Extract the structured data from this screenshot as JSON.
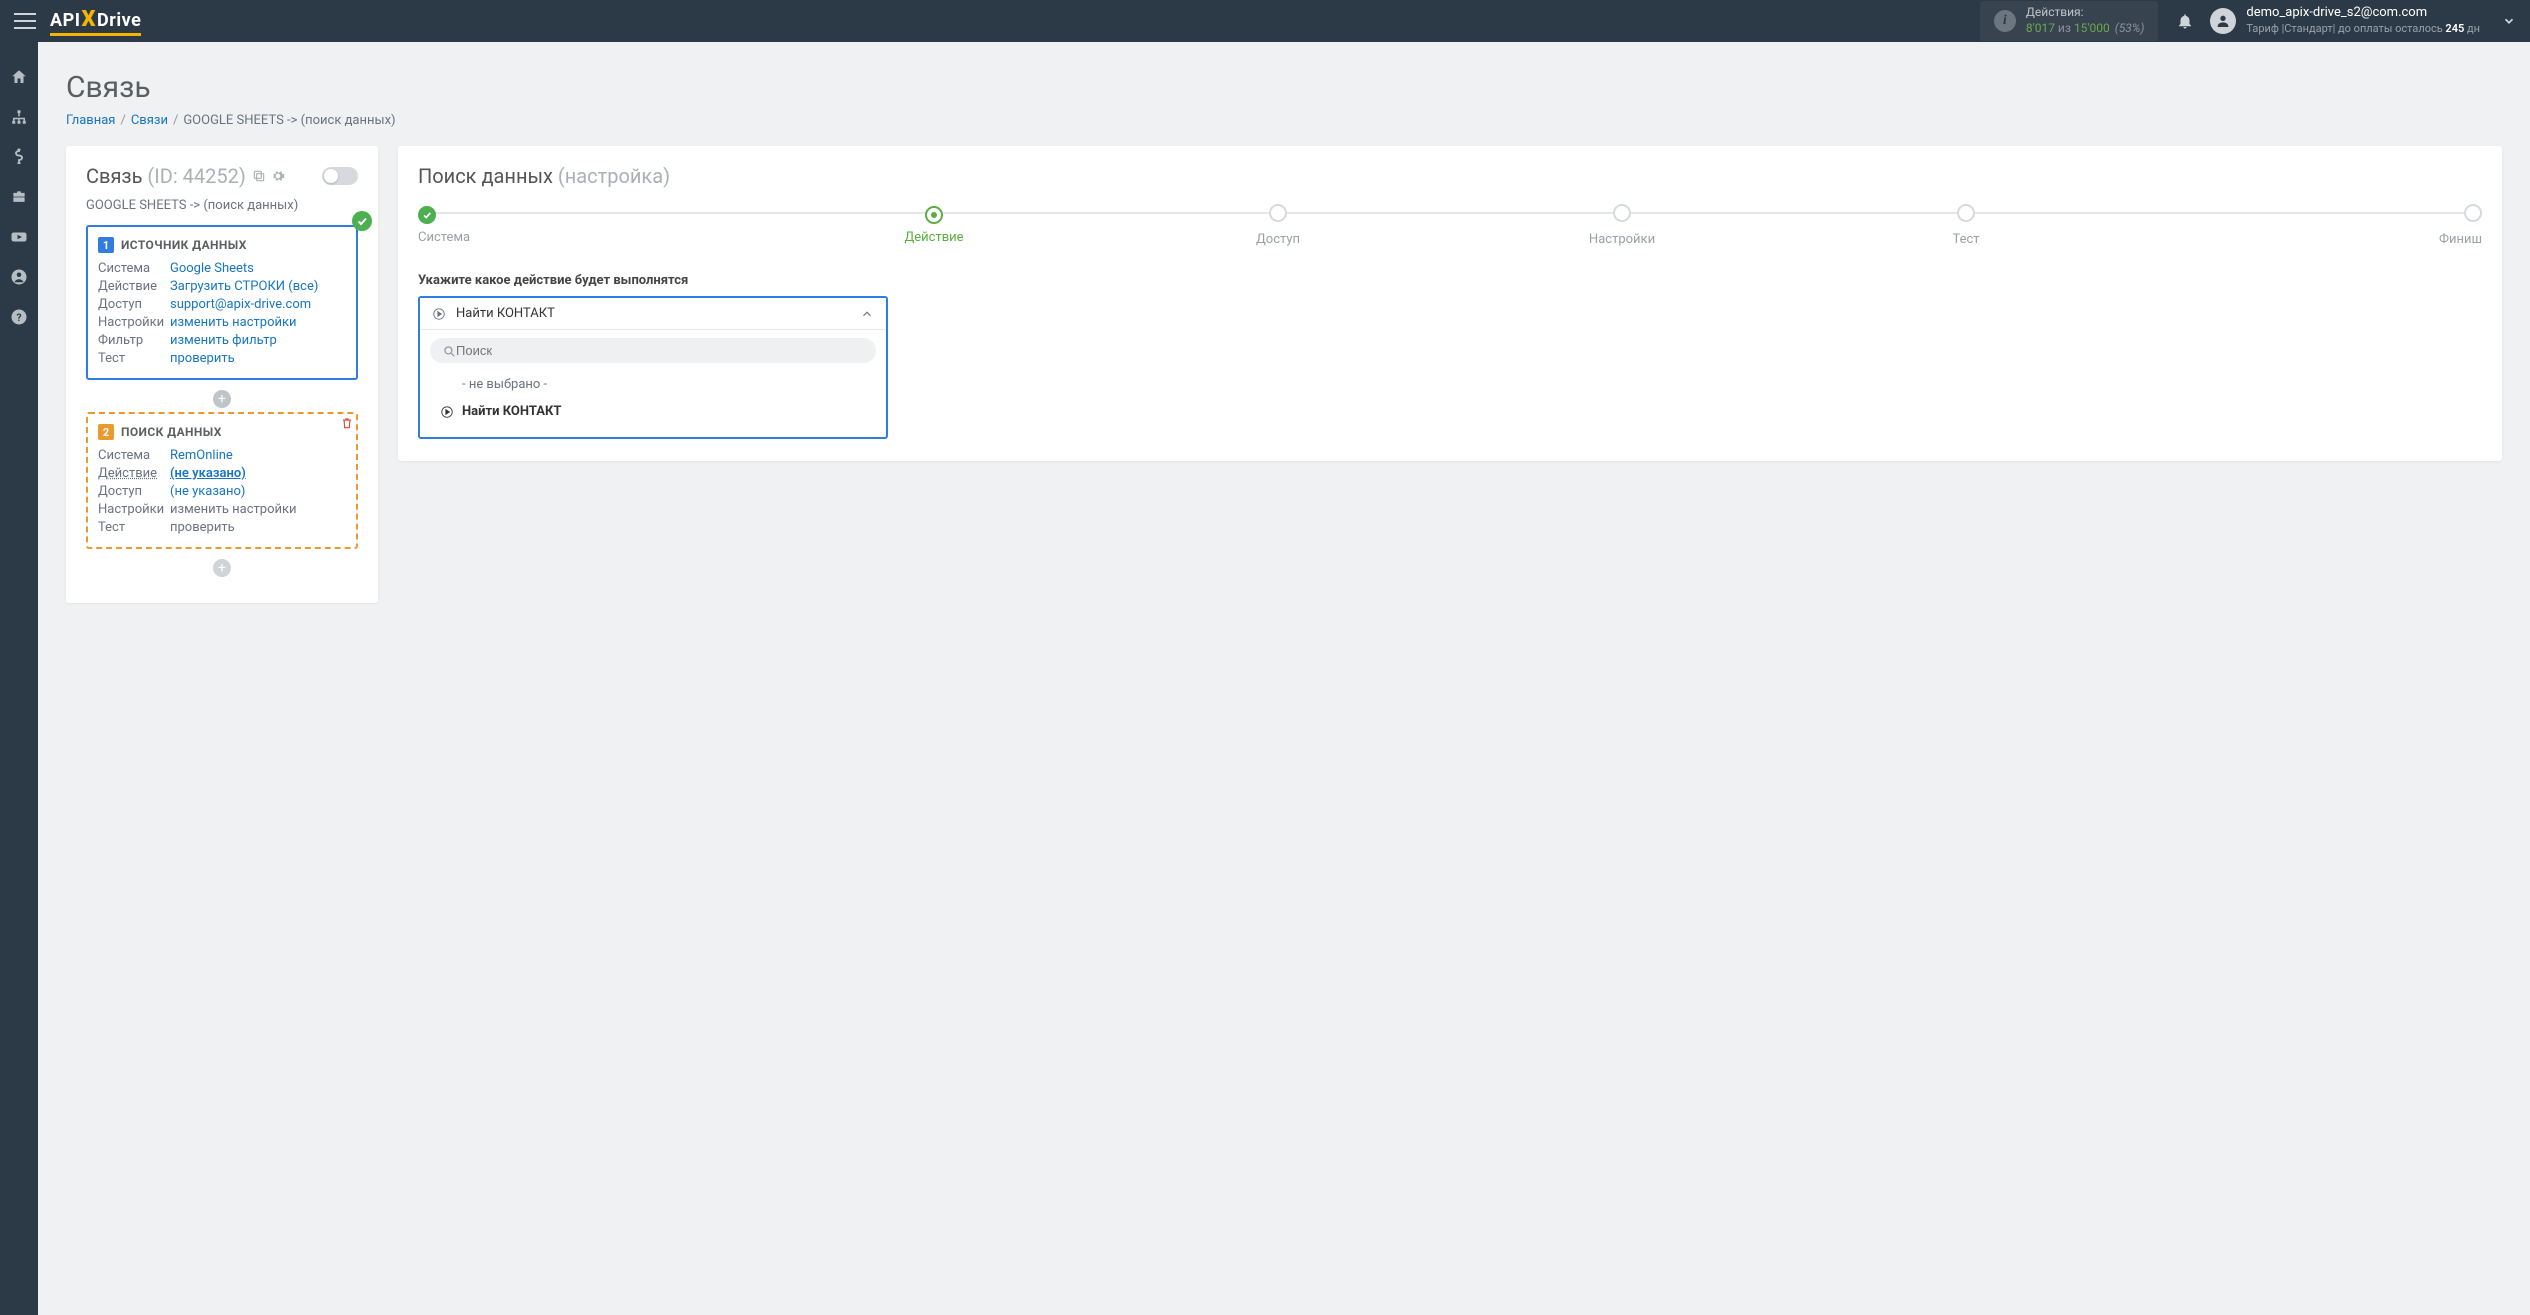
{
  "brand": {
    "api": "API",
    "x": "X",
    "drive": "Drive"
  },
  "header": {
    "actions_label": "Действия:",
    "used": "8'017",
    "of": " из ",
    "limit": "15'000",
    "pct": "(53%)",
    "user_email": "demo_apix-drive_s2@com.com",
    "tariff_prefix": "Тариф |Стандарт| до оплаты осталось ",
    "tariff_days": "245",
    "tariff_suffix": " дн"
  },
  "page": {
    "title": "Связь",
    "crumbs": {
      "home": "Главная",
      "links": "Связи",
      "current": "GOOGLE SHEETS -> (поиск данных)"
    }
  },
  "left": {
    "title": "Связь",
    "id_text": "(ID: 44252)",
    "path": "GOOGLE SHEETS -> (поиск данных)",
    "block1": {
      "title": "ИСТОЧНИК ДАННЫХ",
      "rows": {
        "system_k": "Система",
        "system_v": "Google Sheets",
        "action_k": "Действие",
        "action_v": "Загрузить СТРОКИ (все)",
        "access_k": "Доступ",
        "access_v": "support@apix-drive.com",
        "settings_k": "Настройки",
        "settings_v": "изменить настройки",
        "filter_k": "Фильтр",
        "filter_v": "изменить фильтр",
        "test_k": "Тест",
        "test_v": "проверить"
      }
    },
    "block2": {
      "title": "ПОИСК ДАННЫХ",
      "rows": {
        "system_k": "Система",
        "system_v": "RemOnline",
        "action_k": "Действие",
        "action_v": "(не указано)",
        "access_k": "Доступ",
        "access_v": "(не указано)",
        "settings_k": "Настройки",
        "settings_v": "изменить настройки",
        "test_k": "Тест",
        "test_v": "проверить"
      }
    }
  },
  "right": {
    "title": "Поиск данных",
    "subtitle": "(настройка)",
    "steps": [
      "Система",
      "Действие",
      "Доступ",
      "Настройки",
      "Тест",
      "Финиш"
    ],
    "section_label": "Укажите какое действие будет выполнятся",
    "dd_selected": "Найти КОНТАКТ",
    "search_placeholder": "Поиск",
    "options": {
      "none": "- не выбрано -",
      "opt1": "Найти КОНТАКТ"
    }
  }
}
